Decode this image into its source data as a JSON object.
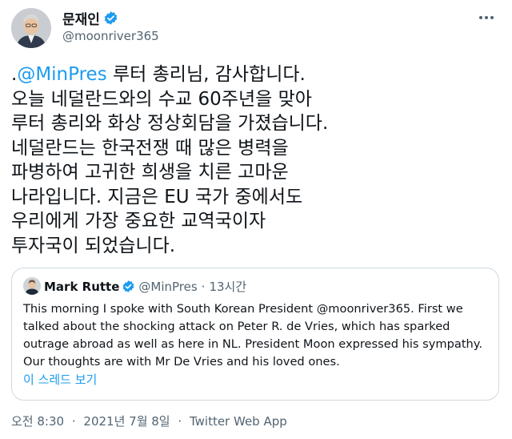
{
  "author": {
    "display_name": "문재인",
    "handle": "@moonriver365",
    "avatar_icon": "profile-photo",
    "verified_icon": "verified-badge-icon"
  },
  "tweet": {
    "lead": ".",
    "mention": "@MinPres",
    "body": " 루터 총리님, 감사합니다.\n오늘 네덜란드와의 수교 60주년을 맞아\n루터 총리와 화상 정상회담을 가졌습니다.\n네덜란드는 한국전쟁 때 많은 병력을\n파병하여 고귀한 희생을 치른 고마운\n나라입니다. 지금은 EU 국가 중에서도\n우리에게 가장 중요한 교역국이자\n투자국이 되었습니다."
  },
  "quoted": {
    "display_name": "Mark Rutte",
    "handle": "@MinPres",
    "dot": "·",
    "time": "13시간",
    "text": "This morning I spoke with South Korean President @moonriver365. First we talked about the shocking attack on Peter R. de Vries, which has sparked outrage abroad as well as here in NL. President Moon expressed his sympathy. Our thoughts are with Mr De Vries and his loved ones.",
    "thread_link": "이 스레드 보기"
  },
  "meta": {
    "time": "오전 8:30",
    "date": "2021년 7월 8일",
    "source": "Twitter Web App",
    "sep": "·"
  },
  "colors": {
    "accent": "#1d9bf0",
    "text": "#0f1419",
    "muted": "#536471",
    "border": "#cfd9de"
  }
}
